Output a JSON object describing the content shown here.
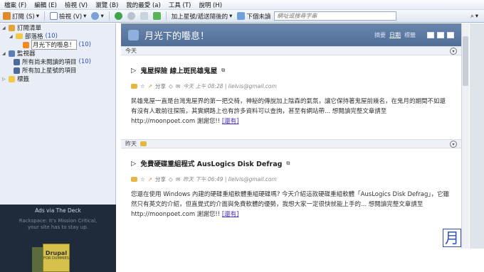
{
  "menu": [
    "檔案 (F)",
    "編輯 (E)",
    "檢視 (V)",
    "瀏覽 (B)",
    "我的最愛 (a)",
    "工具 (T)",
    "說明 (H)"
  ],
  "toolbar": {
    "subscribe": "訂閱 (S)",
    "view": "檢視 (V)",
    "mark_flag": "加上星號/遞送隨後的",
    "next_unread": "下個未讀",
    "search_placeholder": "網址或搜尋字串"
  },
  "sidebar": {
    "root": "訂閱清單",
    "folder": "部落格",
    "folder_count": "(10)",
    "feed": "月光下的囈息！",
    "feed_count": "(10)",
    "monitor": "監視器",
    "unread": "所有尚未閱讀的項目",
    "unread_count": "(10)",
    "starred": "所有加上星號的項目",
    "tags": "標籤"
  },
  "ad": {
    "title": "Ads via The Deck",
    "text": "Rackspace: It's Mission Critical, your site has to stay up.",
    "book_title": "Drupal",
    "book_sub": "FOR DUMMIES"
  },
  "feed": {
    "title": "月光下的囈息！",
    "tabs": [
      "摘要",
      "日期",
      "標籤"
    ],
    "groups": [
      {
        "label": "今天",
        "article": {
          "title": "鬼屋探險 線上斑民雄鬼屋",
          "share": "分享",
          "time": "今天 上午 08:28 | lielvis@gmail.com",
          "body": "民雄鬼屋一直是台灣鬼屋界的第一把交椅，神秘的傳說加上陰森的氣氛，讓它保持著鬼屋前幾名，在鬼月的期間不如還有沒有人敢前往探險，其實網路上也有許多資料可以查詢，甚至有網站帶... 想閱讀完整文章請至 http://moonpoet.com 謝謝您!!",
          "more": "[還有]"
        }
      },
      {
        "label": "昨天",
        "article": {
          "title": "免費硬碟重組程式 AusLogics Disk Defrag",
          "share": "分享",
          "time": "昨天 下午 06:49 | lielvis@gmail.com",
          "body": "您還在使用 Windows 內建的硬碟重組軟體重組硬碟嗎? 今天介紹這款硬碟重組軟體「AusLogics Disk Defrag」，它雖然只有英文的介紹，但直覺式的介面與免費軟體的優勢，我想大家一定很快就能上手的... 想閱讀完整文章請至 http://moonpoet.com 謝謝您!!",
          "more": "[還有]"
        }
      }
    ]
  },
  "watermark": "月",
  "colors": {
    "accent": "#4f6d96",
    "link": "#4a2fb5"
  }
}
